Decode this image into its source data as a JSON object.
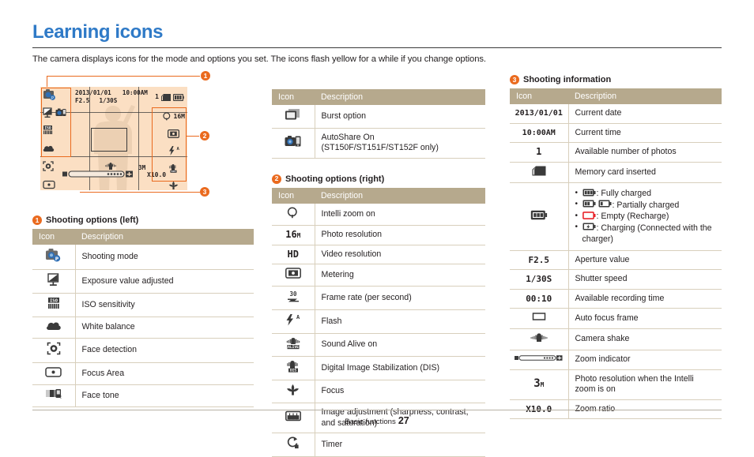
{
  "header": {
    "title": "Learning icons",
    "intro": "The camera displays icons for the mode and options you set. The icons flash yellow for a while if you change options."
  },
  "camera_preview": {
    "osd": {
      "date": "2013/01/01",
      "time": "10:00AM",
      "aperture": "F2.5",
      "shutter": "1/30S",
      "shots_remaining": "1",
      "photo_resolution": "16M",
      "intelli_resolution": "3M",
      "zoom_ratio": "X10.0"
    },
    "callouts": [
      {
        "number": "1",
        "target": "shooting-options-left"
      },
      {
        "number": "2",
        "target": "shooting-options-right"
      },
      {
        "number": "3",
        "target": "shooting-information"
      }
    ]
  },
  "sections": [
    {
      "number": "1",
      "title": "Shooting options (left)",
      "columns": {
        "icon": "Icon",
        "description": "Description"
      },
      "rows": [
        {
          "icon": "shooting-mode-icon",
          "description": "Shooting mode"
        },
        {
          "icon": "exposure-value-icon",
          "description": "Exposure value adjusted"
        },
        {
          "icon": "iso-sensitivity-icon",
          "description": "ISO sensitivity"
        },
        {
          "icon": "white-balance-icon",
          "description": "White balance"
        },
        {
          "icon": "face-detection-icon",
          "description": "Face detection"
        },
        {
          "icon": "focus-area-icon",
          "description": "Focus Area"
        },
        {
          "icon": "face-tone-icon",
          "description": "Face tone"
        },
        {
          "icon": "burst-option-icon",
          "description": "Burst option"
        },
        {
          "icon": "autoshare-icon",
          "description": "AutoShare On\n(ST150F/ST151F/ST152F only)"
        }
      ]
    },
    {
      "number": "2",
      "title": "Shooting options (right)",
      "columns": {
        "icon": "Icon",
        "description": "Description"
      },
      "rows": [
        {
          "icon": "intelli-zoom-icon",
          "description": "Intelli zoom on"
        },
        {
          "icon": "photo-resolution-icon",
          "description": "Photo resolution"
        },
        {
          "icon": "video-resolution-icon",
          "description": "Video resolution"
        },
        {
          "icon": "metering-icon",
          "description": "Metering"
        },
        {
          "icon": "frame-rate-icon",
          "description": "Frame rate (per second)"
        },
        {
          "icon": "flash-icon",
          "description": "Flash"
        },
        {
          "icon": "sound-alive-icon",
          "description": "Sound Alive on"
        },
        {
          "icon": "dis-icon",
          "description": "Digital Image Stabilization (DIS)"
        },
        {
          "icon": "focus-macro-icon",
          "description": "Focus"
        },
        {
          "icon": "image-adjustment-icon",
          "description": "Image adjustment (sharpness, contrast, and saturation)"
        },
        {
          "icon": "timer-icon",
          "description": "Timer"
        }
      ]
    },
    {
      "number": "3",
      "title": "Shooting information",
      "columns": {
        "icon": "Icon",
        "description": "Description"
      },
      "rows": [
        {
          "icon": "2013/01/01",
          "description": "Current date"
        },
        {
          "icon": "10:00AM",
          "description": "Current time"
        },
        {
          "icon": "1",
          "description": "Available number of photos"
        },
        {
          "icon": "memory-card-icon",
          "description": "Memory card inserted"
        },
        {
          "icon": "battery-icon",
          "description": "battery-list"
        },
        {
          "icon": "F2.5",
          "description": "Aperture value"
        },
        {
          "icon": "1/30S",
          "description": "Shutter speed"
        },
        {
          "icon": "00:10",
          "description": "Available recording time"
        },
        {
          "icon": "auto-focus-frame-icon",
          "description": "Auto focus frame"
        },
        {
          "icon": "camera-shake-icon",
          "description": "Camera shake"
        },
        {
          "icon": "zoom-indicator-icon",
          "description": "Zoom indicator"
        },
        {
          "icon": "3M",
          "description": "Photo resolution when the Intelli zoom is on"
        },
        {
          "icon": "X10.0",
          "description": "Zoom ratio"
        }
      ]
    }
  ],
  "battery_list": [
    {
      "icon": "battery-full-icon",
      "text": ": Fully charged"
    },
    {
      "icon": "battery-partial-icon",
      "text": ": Partially charged"
    },
    {
      "icon": "battery-empty-icon",
      "text": ": Empty (Recharge)"
    },
    {
      "icon": "battery-charging-icon",
      "text": ": Charging (Connected with the charger)"
    }
  ],
  "footer": {
    "section": "Basic functions",
    "page": "27"
  },
  "colors": {
    "title_blue": "#2f7ac7",
    "table_header_tan": "#b6a98d",
    "badge_orange": "#ea6a1e",
    "lcd_peach": "#fbdfc3",
    "row_border": "#d8cfbc",
    "empty_battery_red": "#e8232a"
  }
}
